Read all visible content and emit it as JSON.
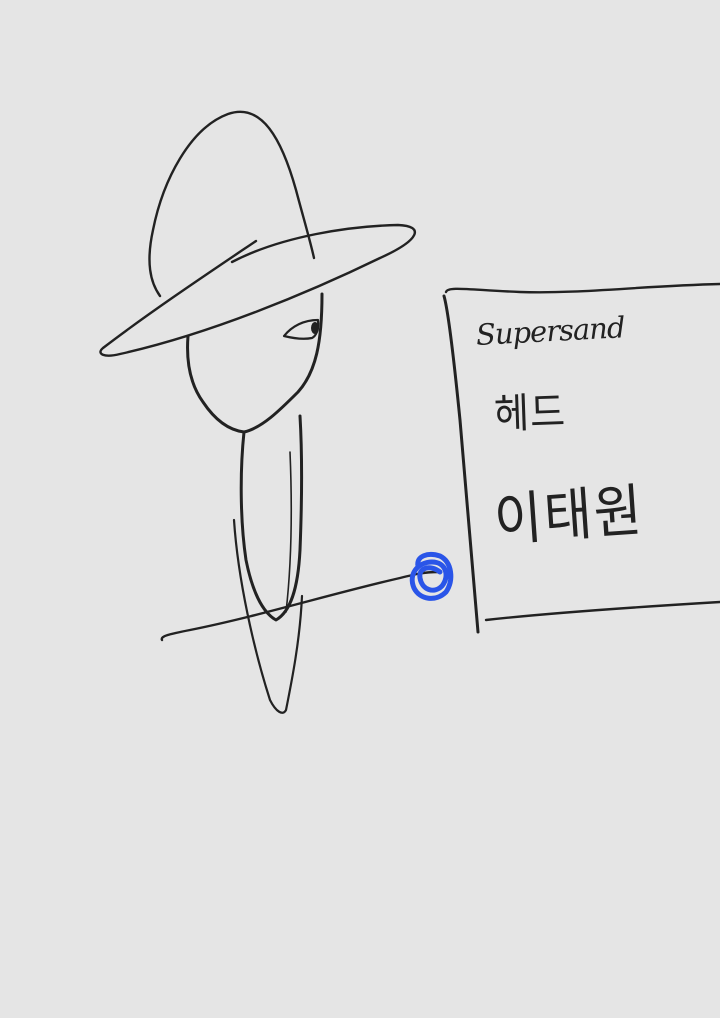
{
  "sketch": {
    "background_color": "#e5e5e5",
    "ink_color": "#222222",
    "highlight_color": "#2a55e8",
    "sign": {
      "line1": "Supersand",
      "line2": "헤드",
      "line3": "이태원"
    }
  }
}
